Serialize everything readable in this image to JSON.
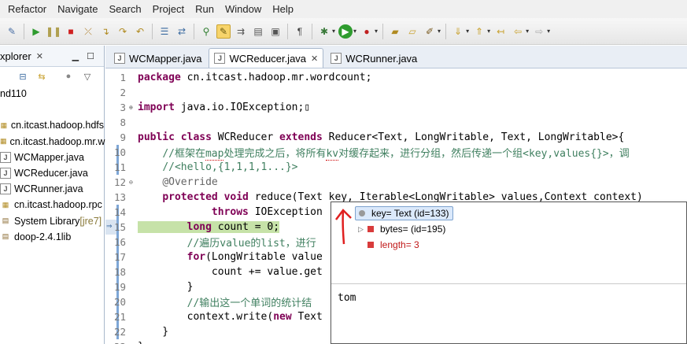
{
  "menubar": [
    "Refactor",
    "Navigate",
    "Search",
    "Project",
    "Run",
    "Window",
    "Help"
  ],
  "explorer": {
    "tab_label": "xplorer",
    "tree": [
      {
        "label": "nd110",
        "icon": "",
        "extra": ""
      },
      {
        "label": "",
        "icon": "",
        "extra": ""
      },
      {
        "label": "cn.itcast.hadoop.hdfs",
        "icon": "package-icon",
        "extra": ""
      },
      {
        "label": "cn.itcast.hadoop.mr.w",
        "icon": "package-icon",
        "extra": ""
      },
      {
        "label": "WCMapper.java",
        "icon": "java-file-icon",
        "extra": ""
      },
      {
        "label": "WCReducer.java",
        "icon": "java-file-icon",
        "extra": ""
      },
      {
        "label": "WCRunner.java",
        "icon": "java-file-icon",
        "extra": ""
      },
      {
        "label": "cn.itcast.hadoop.rpc",
        "icon": "package-icon",
        "extra": ""
      },
      {
        "label": "System Library ",
        "icon": "library-icon",
        "extra": "[jre7]"
      },
      {
        "label": "doop-2.4.1lib",
        "icon": "library-icon",
        "extra": ""
      }
    ]
  },
  "editor": {
    "tabs": [
      {
        "label": "WCMapper.java",
        "active": false
      },
      {
        "label": "WCReducer.java",
        "active": true
      },
      {
        "label": "WCRunner.java",
        "active": false
      }
    ],
    "lines": [
      {
        "n": "1",
        "fold": "",
        "html": "<span class='kw'>package</span> cn.itcast.hadoop.mr.wordcount;"
      },
      {
        "n": "2",
        "fold": "",
        "html": ""
      },
      {
        "n": "3",
        "fold": "⊕",
        "html": "<span class='kw'>import</span> java.io.IOException;▯"
      },
      {
        "n": "8",
        "fold": "",
        "html": ""
      },
      {
        "n": "9",
        "fold": "",
        "html": "<span class='kw'>public class</span> WCReducer <span class='kw'>extends</span> Reducer&lt;Text, LongWritable, Text, LongWritable&gt;{"
      },
      {
        "n": "10",
        "fold": "",
        "html": "    <span class='cm'>//框架在<span class='sq'>map</span>处理完成之后，将所有<span class='sq'>kv</span>对缓存起来，进行分组，然后传递一个组&lt;key,values{}&gt;，调</span>"
      },
      {
        "n": "11",
        "fold": "",
        "html": "    <span class='cm'>//&lt;hello,{1,1,1,1...}&gt;</span>"
      },
      {
        "n": "12",
        "fold": "⊖",
        "html": "    <span class='an'>@Override</span>"
      },
      {
        "n": "13",
        "fold": "",
        "html": "    <span class='kw'>protected void</span> reduce(Text key, Iterable&lt;LongWritable&gt; values,Context context)"
      },
      {
        "n": "14",
        "fold": "",
        "html": "            <span class='kw'>throws</span> IOException"
      },
      {
        "n": "15",
        "fold": "",
        "html": "<span class='hl'>        <span class='kw'>long</span> count = 0;</span>"
      },
      {
        "n": "16",
        "fold": "",
        "html": "        <span class='cm'>//遍历value的list，进行</span>"
      },
      {
        "n": "17",
        "fold": "",
        "html": "        <span class='kw'>for</span>(LongWritable value"
      },
      {
        "n": "18",
        "fold": "",
        "html": "            count += value.get"
      },
      {
        "n": "19",
        "fold": "",
        "html": "        }"
      },
      {
        "n": "20",
        "fold": "",
        "html": "        <span class='cm'>//输出这一个单词的统计结</span>"
      },
      {
        "n": "21",
        "fold": "",
        "html": "        context.write(<span class='kw'>new</span> Text"
      },
      {
        "n": "22",
        "fold": "",
        "html": "    }"
      },
      {
        "n": "23",
        "fold": "",
        "html": "}"
      }
    ]
  },
  "popup": {
    "rows": [
      {
        "text": "key= Text  (id=133)",
        "indent": 0,
        "twisty": "",
        "selected": true,
        "red": false
      },
      {
        "text": "bytes= (id=195)",
        "indent": 1,
        "twisty": "▷",
        "selected": false,
        "red": false
      },
      {
        "text": "length= 3",
        "indent": 1,
        "twisty": "",
        "selected": false,
        "red": true
      }
    ],
    "detail": "tom"
  }
}
